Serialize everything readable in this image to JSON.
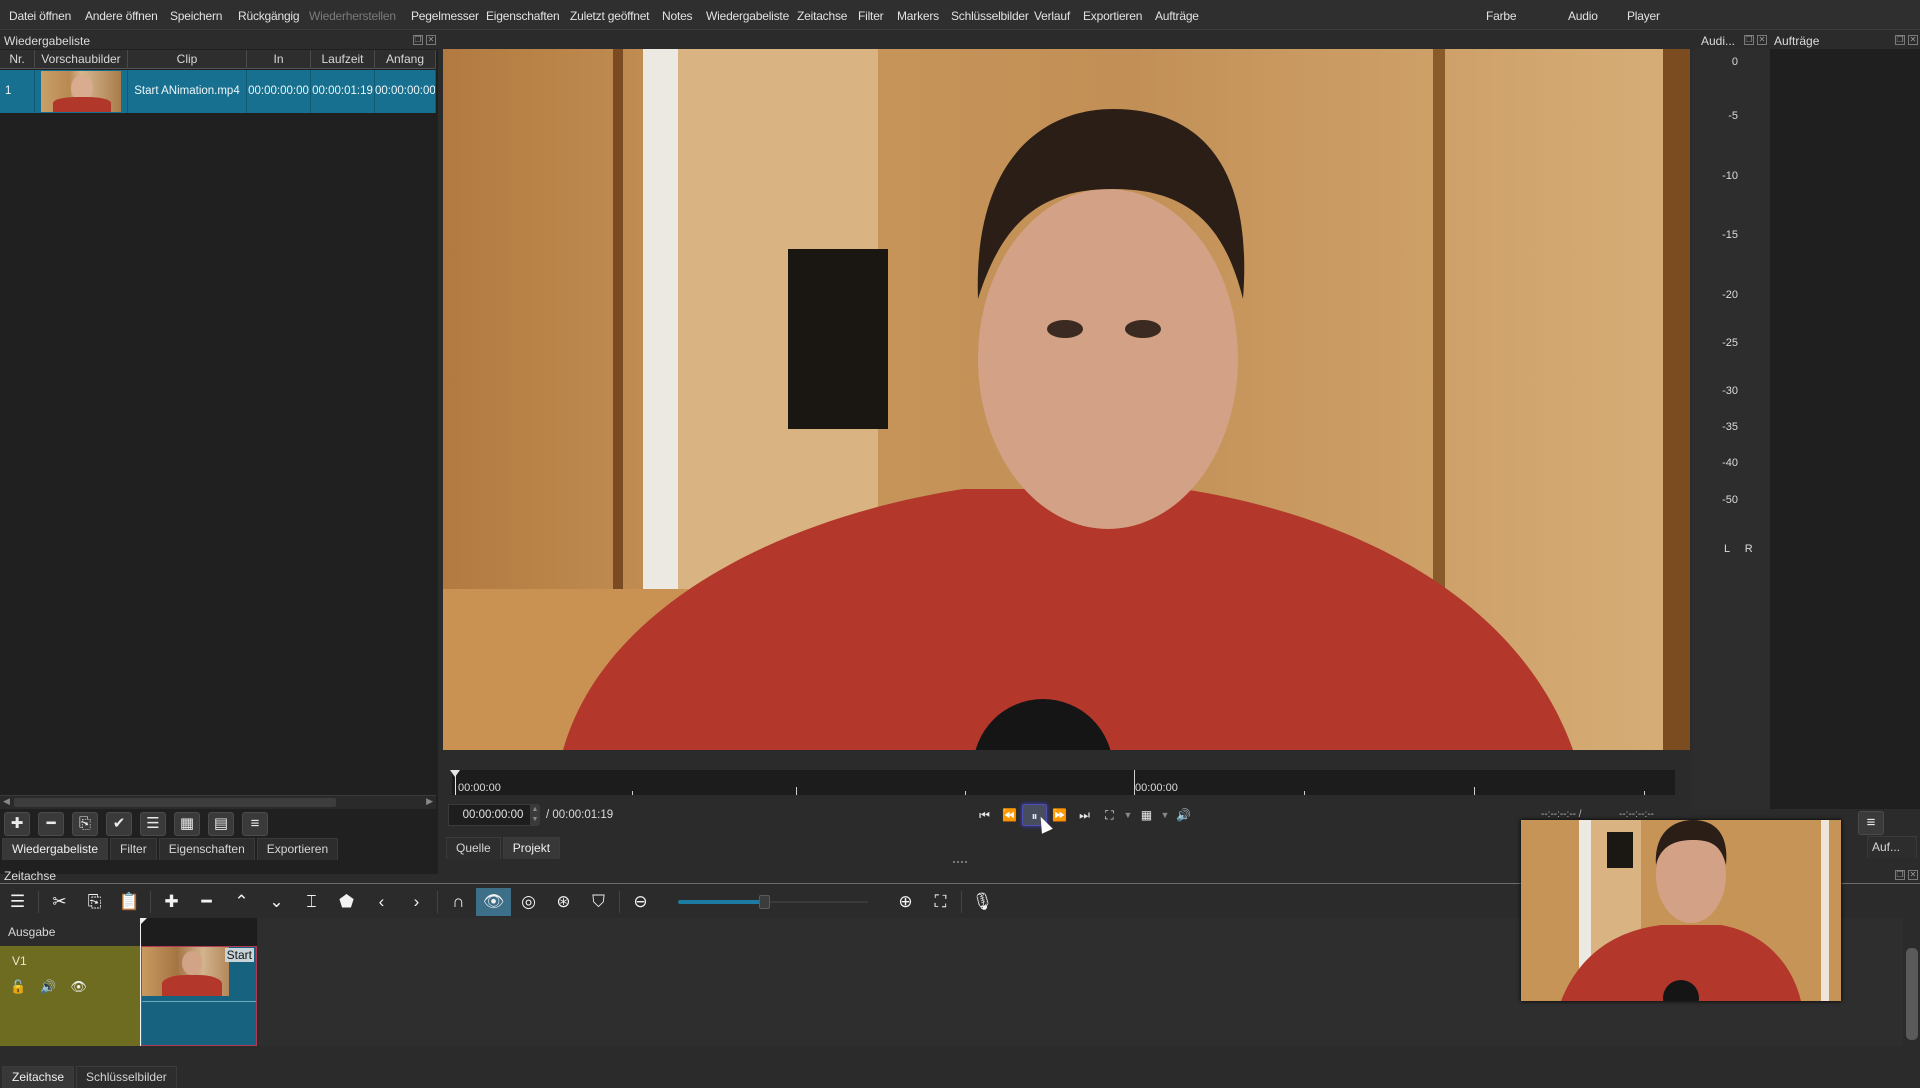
{
  "toolbar": {
    "items": [
      {
        "label": "Datei öffnen",
        "enabled": true
      },
      {
        "label": "Andere öffnen",
        "enabled": true
      },
      {
        "label": "Speichern",
        "enabled": true
      },
      {
        "label": "Rückgängig",
        "enabled": true
      },
      {
        "label": "Wiederherstellen",
        "enabled": false
      },
      {
        "label": "Pegelmesser",
        "enabled": true
      },
      {
        "label": "Eigenschaften",
        "enabled": true
      },
      {
        "label": "Zuletzt geöffnet",
        "enabled": true
      },
      {
        "label": "Notes",
        "enabled": true
      },
      {
        "label": "Wiedergabeliste",
        "enabled": true
      },
      {
        "label": "Zeitachse",
        "enabled": true
      },
      {
        "label": "Filter",
        "enabled": true
      },
      {
        "label": "Markers",
        "enabled": true
      },
      {
        "label": "Schlüsselbilder",
        "enabled": true
      },
      {
        "label": "Verlauf",
        "enabled": true
      },
      {
        "label": "Exportieren",
        "enabled": true
      },
      {
        "label": "Aufträge",
        "enabled": true
      }
    ],
    "layouts": [
      "Farbe",
      "Audio",
      "Player"
    ]
  },
  "playlist": {
    "title": "Wiedergabeliste",
    "columns": [
      "Nr.",
      "Vorschaubilder",
      "Clip",
      "In",
      "Laufzeit",
      "Anfang"
    ],
    "rows": [
      {
        "nr": "1",
        "clip": "Start ANimation.mp4",
        "in": "00:00:00:00",
        "duration": "00:00:01:19",
        "start": "00:00:00:00"
      }
    ],
    "tools": [
      "add-icon",
      "remove-icon",
      "update-icon",
      "check-icon",
      "list-view-icon",
      "grid-view-icon",
      "detail-view-icon",
      "menu-icon"
    ],
    "tabs": [
      "Wiedergabeliste",
      "Filter",
      "Eigenschaften",
      "Exportieren"
    ]
  },
  "player": {
    "scrub_labels": [
      "00:00:00",
      "00:00:00"
    ],
    "timecode": "00:00:00:00",
    "duration": "/ 00:00:01:19",
    "tabs": [
      "Quelle",
      "Projekt"
    ],
    "state": "playing"
  },
  "audio_meter": {
    "title": "Audi...",
    "scale": [
      "0",
      "-5",
      "-10",
      "-15",
      "-20",
      "-25",
      "-30",
      "-35",
      "-40",
      "-50"
    ],
    "channels": "L R"
  },
  "jobs": {
    "title": "Aufträge",
    "tab_label": "Auf...",
    "timecodes": [
      "--:--:--:-- /",
      "--:--:--:--"
    ]
  },
  "timeline": {
    "title": "Zeitachse",
    "output_label": "Ausgabe",
    "tracks": [
      {
        "name": "V1"
      }
    ],
    "clips": [
      {
        "label": "Start"
      }
    ],
    "zoom_level": 0.45,
    "bottom_tabs": [
      "Zeitachse",
      "Schlüsselbilder"
    ]
  }
}
